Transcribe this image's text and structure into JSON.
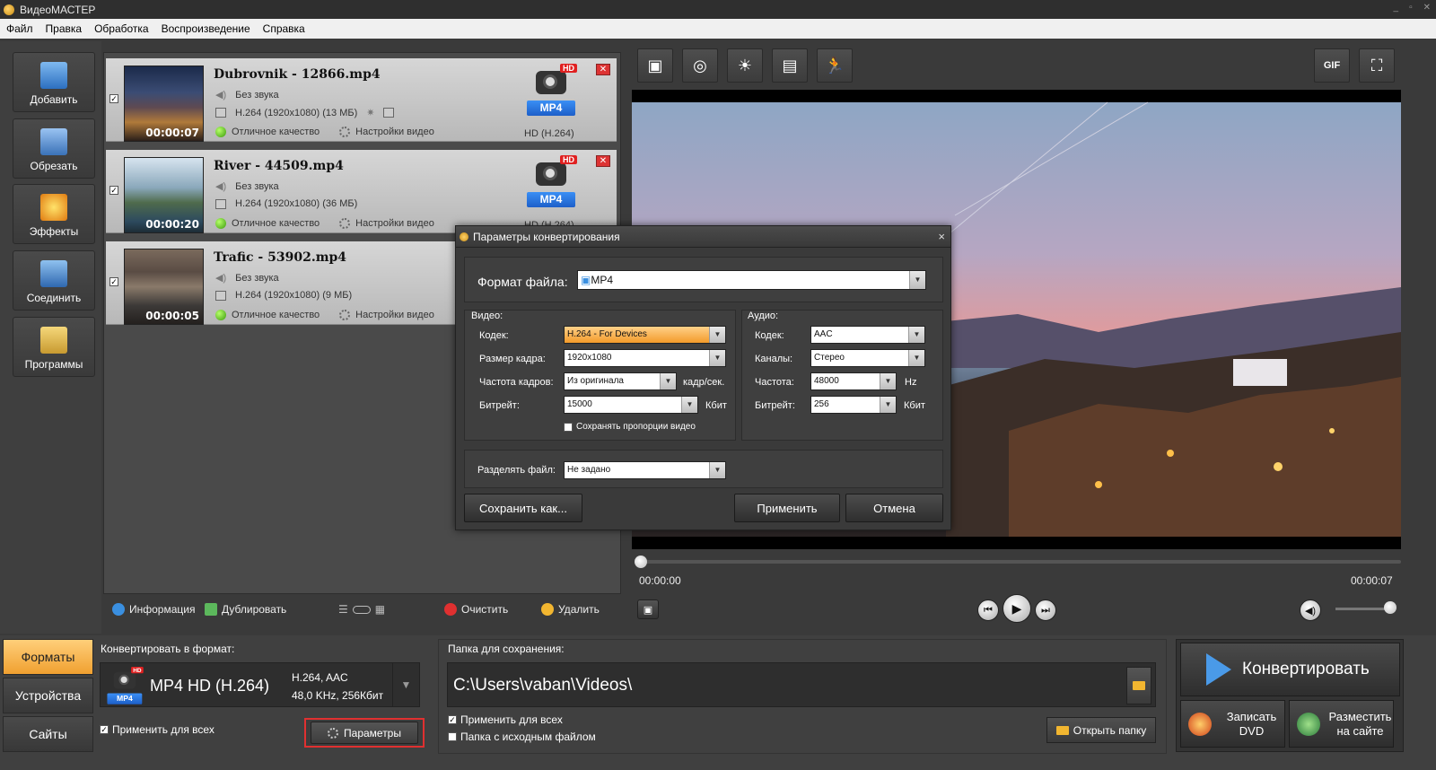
{
  "app": {
    "title": "ВидеоМАСТЕР"
  },
  "menu": [
    "Файл",
    "Правка",
    "Обработка",
    "Воспроизведение",
    "Справка"
  ],
  "sidebar": {
    "items": [
      {
        "label": "Добавить",
        "icon": "add-video-icon"
      },
      {
        "label": "Обрезать",
        "icon": "scissors-icon"
      },
      {
        "label": "Эффекты",
        "icon": "sparkle-icon"
      },
      {
        "label": "Соединить",
        "icon": "join-icon"
      },
      {
        "label": "Программы",
        "icon": "disc-programs-icon"
      }
    ]
  },
  "files": [
    {
      "name": "Dubrovnik - 12866.mp4",
      "duration": "00:00:07",
      "audio": "Без звука",
      "video": "H.264 (1920x1080) (13 МБ)",
      "quality": "Отличное качество",
      "settings": "Настройки видео",
      "format": "HD (H.264)",
      "badge": "HD",
      "tag": "MP4",
      "checked": "✓"
    },
    {
      "name": "River - 44509.mp4",
      "duration": "00:00:20",
      "audio": "Без звука",
      "video": "H.264 (1920x1080) (36 МБ)",
      "quality": "Отличное качество",
      "settings": "Настройки видео",
      "format": "HD (H.264)",
      "badge": "HD",
      "tag": "MP4",
      "checked": "✓"
    },
    {
      "name": "Trafic - 53902.mp4",
      "duration": "00:00:05",
      "audio": "Без звука",
      "video": "H.264 (1920x1080) (9 МБ)",
      "quality": "Отличное качество",
      "settings": "Настройки видео",
      "checked": "✓"
    }
  ],
  "listbar": {
    "info": "Информация",
    "duplicate": "Дублировать",
    "clear": "Очистить",
    "delete": "Удалить"
  },
  "player": {
    "time_start": "00:00:00",
    "time_end": "00:00:07",
    "gif_label": "GIF",
    "progress": 0
  },
  "dialog": {
    "title": "Параметры конвертирования",
    "close": "×",
    "format_label": "Формат файла:",
    "format_value": "MP4",
    "video_group": "Видео:",
    "audio_group": "Аудио:",
    "video": {
      "codec_label": "Кодек:",
      "codec_value": "H.264 - For Devices",
      "size_label": "Размер кадра:",
      "size_value": "1920x1080",
      "fps_label": "Частота кадров:",
      "fps_value": "Из оригинала",
      "fps_unit": "кадр/сек.",
      "bitrate_label": "Битрейт:",
      "bitrate_value": "15000",
      "bitrate_unit": "Кбит",
      "keep_aspect": "Сохранять пропорции видео"
    },
    "audio": {
      "codec_label": "Кодек:",
      "codec_value": "AAC",
      "channels_label": "Каналы:",
      "channels_value": "Стерео",
      "freq_label": "Частота:",
      "freq_value": "48000",
      "freq_unit": "Hz",
      "bitrate_label": "Битрейт:",
      "bitrate_value": "256",
      "bitrate_unit": "Кбит"
    },
    "split_label": "Разделять файл:",
    "split_value": "Не задано",
    "save_as": "Сохранить как...",
    "apply": "Применить",
    "cancel": "Отмена"
  },
  "bottom": {
    "tabs": [
      "Форматы",
      "Устройства",
      "Сайты"
    ],
    "convert_to_label": "Конвертировать в формат:",
    "format_name": "MP4 HD (H.264)",
    "format_codec": "H.264, AAC",
    "format_audio": "48,0 KHz, 256Кбит",
    "format_badge": "HD",
    "format_tag": "MP4",
    "apply_all": "Применить для всех",
    "params": "Параметры",
    "save_folder_label": "Папка для сохранения:",
    "save_path": "C:\\Users\\vaban\\Videos\\",
    "apply_all_2": "Применить для всех",
    "source_folder": "Папка с исходным файлом",
    "open_folder": "Открыть папку",
    "convert": "Конвертировать",
    "burn_dvd": "Записать DVD",
    "publish": "Разместить на сайте"
  },
  "colors": {
    "accent_orange": "#f0a030",
    "close_red": "#d33333",
    "highlight_border": "#e03030",
    "mp4_blue": "#1d5fc9"
  }
}
